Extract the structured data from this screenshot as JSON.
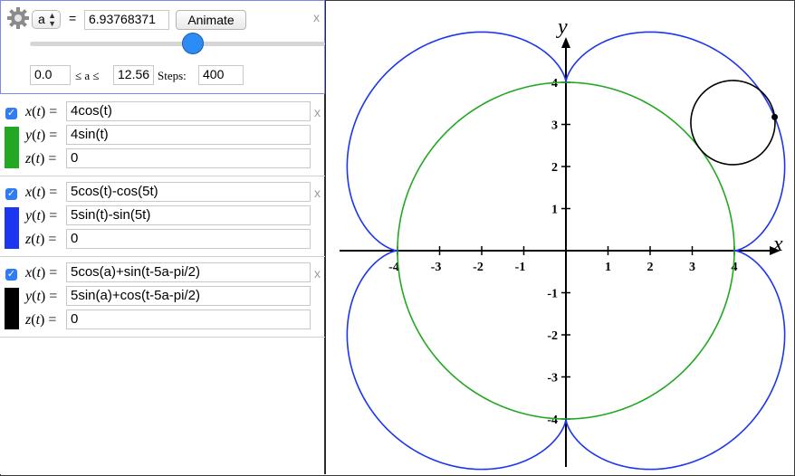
{
  "slider": {
    "variable": "a",
    "equals": "=",
    "value": "6.93768371",
    "animate_label": "Animate",
    "close": "x",
    "fraction": 0.552,
    "min": "0.0",
    "le_a_le": "≤ a ≤",
    "max": "12.56",
    "steps_label": "Steps:",
    "steps": "400"
  },
  "curves": [
    {
      "checked": true,
      "color": "#22a822",
      "x_label": "x",
      "y_label": "y",
      "z_label": "z",
      "x_expr": "4cos(t)",
      "y_expr": "4sin(t)",
      "z_expr": "0",
      "close": "x"
    },
    {
      "checked": true,
      "color": "#1c35f0",
      "x_label": "x",
      "y_label": "y",
      "z_label": "z",
      "x_expr": "5cos(t)-cos(5t)",
      "y_expr": "5sin(t)-sin(5t)",
      "z_expr": "0",
      "close": "x"
    },
    {
      "checked": true,
      "color": "#000000",
      "x_label": "x",
      "y_label": "y",
      "z_label": "z",
      "x_expr": "5cos(a)+sin(t-5a-pi/2)",
      "y_expr": "5sin(a)+cos(t-5a-pi/2)",
      "z_expr": "0",
      "close": "x"
    }
  ],
  "plot": {
    "x_axis_label": "x",
    "y_axis_label": "y",
    "x_ticks": [
      "-4",
      "-3",
      "-2",
      "-1",
      "1",
      "2",
      "3",
      "4"
    ],
    "y_ticks": [
      "4",
      "3",
      "2",
      "1",
      "-1",
      "-2",
      "-3",
      "-4"
    ]
  }
}
